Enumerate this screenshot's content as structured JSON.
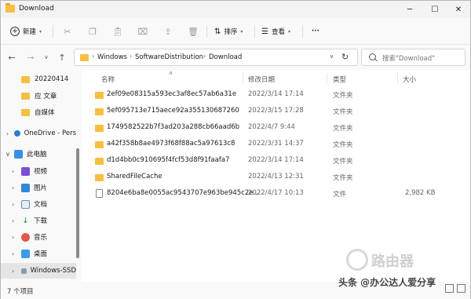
{
  "window": {
    "title": "Download",
    "minimize_icon": "minimize-icon",
    "maximize_icon": "maximize-icon",
    "close_icon": "close-icon"
  },
  "toolbar": {
    "new_label": "新建",
    "sort_label": "排序",
    "view_label": "查看",
    "more_label": "···"
  },
  "address": {
    "crumbs": [
      "Windows",
      "SoftwareDistribution",
      "Download"
    ],
    "search_placeholder": "搜索\"Download\""
  },
  "nav": {
    "items": [
      {
        "label": "20220414",
        "type": "folder"
      },
      {
        "label": "应 文章",
        "type": "folder"
      },
      {
        "label": "自媒体",
        "type": "folder"
      },
      {
        "label": "OneDrive - Pers",
        "type": "cloud"
      },
      {
        "label": "此电脑",
        "type": "pc"
      },
      {
        "label": "视频",
        "type": "video"
      },
      {
        "label": "图片",
        "type": "pictures"
      },
      {
        "label": "文档",
        "type": "documents"
      },
      {
        "label": "下载",
        "type": "downloads"
      },
      {
        "label": "音乐",
        "type": "music"
      },
      {
        "label": "桌面",
        "type": "desktop"
      },
      {
        "label": "Windows-SSD",
        "type": "drive"
      }
    ]
  },
  "columns": {
    "name": "名称",
    "modified": "修改日期",
    "type": "类型",
    "size": "大小"
  },
  "files": [
    {
      "name": "2ef09e08315a593ec3af8ec57ab6a31e",
      "modified": "2022/3/14 17:14",
      "type": "文件夹",
      "size": "",
      "kind": "folder"
    },
    {
      "name": "5ef095713e715aece92a355130687260",
      "modified": "2022/3/15 17:28",
      "type": "文件夹",
      "size": "",
      "kind": "folder"
    },
    {
      "name": "1749582522b7f3ad203a288cb66aad6b",
      "modified": "2022/4/7 9:44",
      "type": "文件夹",
      "size": "",
      "kind": "folder"
    },
    {
      "name": "a42f358b8ae4973f68f88ac5a97613c8",
      "modified": "2022/3/31 14:37",
      "type": "文件夹",
      "size": "",
      "kind": "folder"
    },
    {
      "name": "d1d4bb0c910695f4fcf53d8f91faafa7",
      "modified": "2022/3/14 17:14",
      "type": "文件夹",
      "size": "",
      "kind": "folder"
    },
    {
      "name": "SharedFileCache",
      "modified": "2022/4/13 12:31",
      "type": "文件夹",
      "size": "",
      "kind": "folder"
    },
    {
      "name": "8204e6ba8e0055ac9543707e963be945c2e...",
      "modified": "2022/4/17 10:13",
      "type": "文件",
      "size": "2,982 KB",
      "kind": "file"
    }
  ],
  "status": {
    "count": "7 个项目"
  },
  "watermark": {
    "text": "头条 @办公达人爱分享",
    "logo_text": "路由器"
  }
}
